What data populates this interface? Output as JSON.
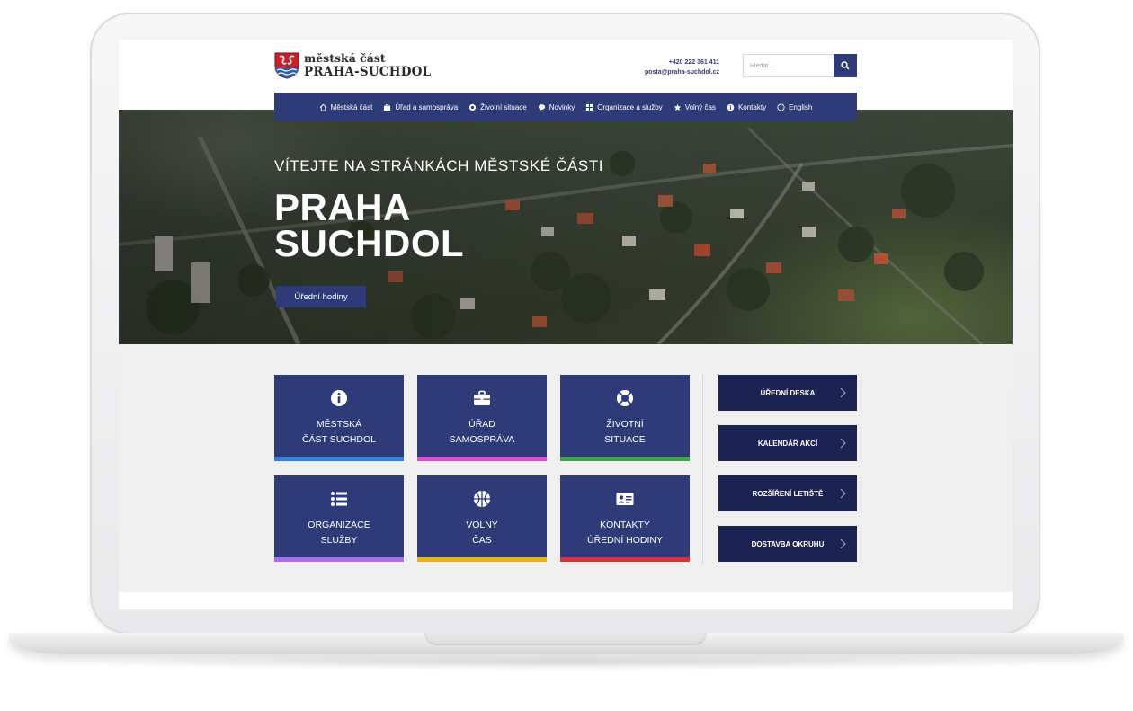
{
  "colors": {
    "primary": "#2f3b78",
    "dark_navy": "#1b2352",
    "bar_blue": "#2f7fe0",
    "bar_pink": "#e04bd6",
    "bar_green": "#3aa64a",
    "bar_purple": "#a86ee8",
    "bar_yellow": "#e6b41d",
    "bar_red": "#d8323c"
  },
  "header": {
    "logo_line1": "městská část",
    "logo_line2": "PRAHA-SUCHDOL",
    "phone": "+420 222 361 411",
    "email": "posta@praha-suchdol.cz",
    "search_placeholder": "Hledat ..."
  },
  "nav": {
    "items": [
      {
        "label": "Městská část",
        "icon": "home-icon"
      },
      {
        "label": "Úřad a samospráva",
        "icon": "briefcase-icon"
      },
      {
        "label": "Životní situace",
        "icon": "lifebuoy-icon"
      },
      {
        "label": "Novinky",
        "icon": "speech-bubble-icon"
      },
      {
        "label": "Organizace a služby",
        "icon": "grid-icon"
      },
      {
        "label": "Volný čas",
        "icon": "star-icon"
      },
      {
        "label": "Kontakty",
        "icon": "info-icon"
      },
      {
        "label": "English",
        "icon": "globe-icon"
      }
    ]
  },
  "hero": {
    "subtitle": "Vítejte na stránkách městské části",
    "title_line1": "PRAHA",
    "title_line2": "SUCHDOL",
    "button": "Úřední hodiny"
  },
  "tiles": [
    {
      "label": "Městská\nčást Suchdol",
      "icon": "info-icon"
    },
    {
      "label": "Úřad\nsamospráva",
      "icon": "briefcase-icon"
    },
    {
      "label": "Životní\nsituace",
      "icon": "lifebuoy-icon"
    },
    {
      "label": "Organizace\nslužby",
      "icon": "list-icon"
    },
    {
      "label": "Volný\nčas",
      "icon": "basketball-icon"
    },
    {
      "label": "Kontakty\núřední hodiny",
      "icon": "id-card-icon"
    }
  ],
  "side_links": [
    "Úřední deska",
    "Kalendář akcí",
    "Rozšíření letiště",
    "Dostavba okruhu"
  ]
}
